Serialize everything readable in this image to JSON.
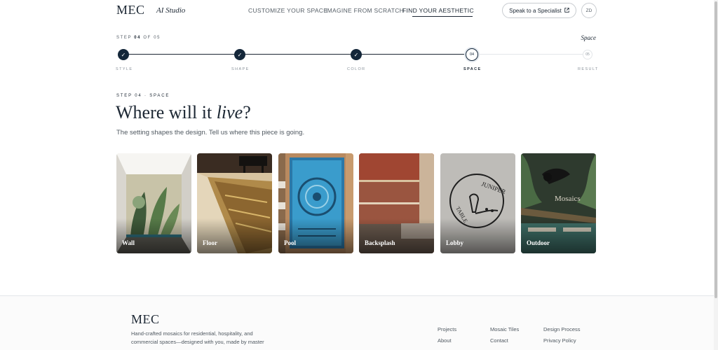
{
  "header": {
    "logo": "MEC",
    "logo_sub": "AI Studio",
    "nav": [
      {
        "label": "CUSTOMIZE YOUR SPACE"
      },
      {
        "label": "IMAGINE FROM SCRATCH"
      },
      {
        "label": "FIND YOUR AESTHETIC",
        "active": true
      }
    ],
    "specialist_label": "Speak to a Specialist",
    "avatar": "ZD"
  },
  "stepper": {
    "step_prefix": "STEP",
    "current_number": "04",
    "of_text": "OF 05",
    "current_name": "Space",
    "steps": [
      {
        "label": "STYLE",
        "state": "done",
        "mark": "✓"
      },
      {
        "label": "SHAPE",
        "state": "done",
        "mark": "✓"
      },
      {
        "label": "COLOR",
        "state": "done",
        "mark": "✓"
      },
      {
        "label": "SPACE",
        "state": "current",
        "mark": "04"
      },
      {
        "label": "RESULT",
        "state": "future",
        "mark": "05"
      }
    ]
  },
  "content": {
    "eyebrow": "STEP 04 · SPACE",
    "title_pre": "Where will it ",
    "title_em": "live",
    "title_post": "?",
    "lede": "The setting shapes the design. Tell us where this piece is going."
  },
  "cards": [
    {
      "label": "Wall"
    },
    {
      "label": "Floor"
    },
    {
      "label": "Pool"
    },
    {
      "label": "Backsplash"
    },
    {
      "label": "Lobby"
    },
    {
      "label": "Outdoor"
    }
  ],
  "card_art_text": {
    "lobby_word_1": "JUNIPER",
    "lobby_word_2": "TABLE",
    "outdoor_word": "Mosaics"
  },
  "footer": {
    "logo": "MEC",
    "tagline": "Hand-crafted mosaics for residential, hospitality, and commercial spaces—designed with you, made by master",
    "links": [
      "Projects",
      "About",
      "Mosaic Tiles",
      "Contact",
      "Design Process",
      "Privacy Policy"
    ]
  },
  "colors": {
    "navy": "#14273a",
    "text": "#1c2733",
    "muted": "#8a939b"
  },
  "icons": {
    "check": "check-icon",
    "external": "external-link-icon"
  }
}
